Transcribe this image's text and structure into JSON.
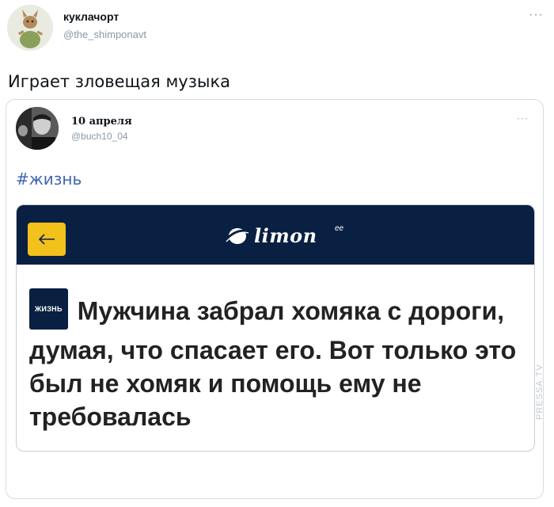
{
  "tweet": {
    "author_name": "куклачорт",
    "author_handle": "@the_shimponavt",
    "more": "···",
    "text": "Играет зловещая музыка"
  },
  "quoted": {
    "author_name": "10 апреля",
    "author_handle": "@buch10_04",
    "more": "···",
    "hashtag": "#жизнь",
    "article": {
      "logo_text": "limon",
      "logo_sup": "ee",
      "tag": "ЖИЗНЬ",
      "headline": "Мужчина забрал хомяка с дороги, думая, что спасает его. Вот только это был не хомяк и помощь ему не требовалась"
    }
  },
  "watermark": "PRESSA.TV",
  "colors": {
    "accent": "#0a2042",
    "back_button": "#f2c11b",
    "hashtag": "#3f63b5",
    "muted": "#8b98a5"
  },
  "icons": [
    "back-arrow-icon",
    "limon-logo-icon",
    "more-icon"
  ]
}
